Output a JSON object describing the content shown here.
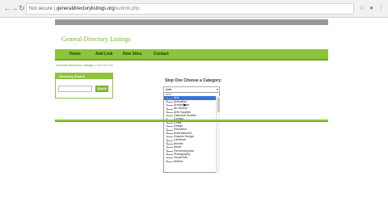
{
  "browser": {
    "security_label": "Not secure",
    "host": "generaldirectorylistings.org",
    "path": "/submit.php",
    "nav": {
      "back_icon": "arrow-left-icon",
      "forward_icon": "arrow-right-icon",
      "reload_icon": "reload-icon"
    }
  },
  "site": {
    "title": "General Directory Listings",
    "menu": [
      "Home",
      "Add Link",
      "New Sites",
      "Contact"
    ],
    "breadcrumb_home": "General Directory Listings",
    "breadcrumb_sep": " » ",
    "breadcrumb_current": "Submit Link"
  },
  "search": {
    "heading": "Directory Search",
    "input_value": "",
    "button_label": "Search"
  },
  "form": {
    "step_title": "Step One Choose a Category:",
    "selected_value": "Arts",
    "dropdown_items": [
      "Arts",
      "Animation",
      "Architecture",
      "Art History",
      "Arts Supplies",
      "Classical Studies",
      "Comics",
      "Crafts",
      "Design",
      "Education",
      "Entertainment",
      "Graphic Design",
      "Literature",
      "Movies",
      "Music",
      "Performing Arts",
      "Photography",
      "Visual Arts",
      "Writers"
    ],
    "dropdown_first": "Arts",
    "highlighted_index": 1
  },
  "colors": {
    "accent": "#8cc43c",
    "title_green": "#79b426",
    "highlight": "#3874d8"
  }
}
